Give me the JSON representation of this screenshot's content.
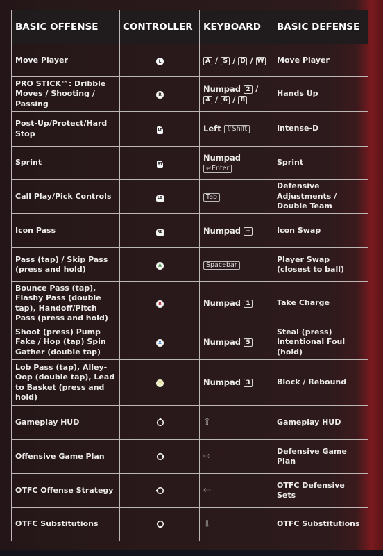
{
  "headers": {
    "offense": "BASIC OFFENSE",
    "controller": "CONTROLLER",
    "keyboard": "KEYBOARD",
    "defense": "BASIC DEFENSE"
  },
  "rows": [
    {
      "offense": "Move Player",
      "controller": {
        "icon": "left-stick-icon",
        "label": "L"
      },
      "keyboard_prefix": "",
      "keys": [
        "A",
        "S",
        "D",
        "W"
      ],
      "defense": "Move Player"
    },
    {
      "offense": "PRO STICK™: Dribble Moves / Shooting / Passing",
      "controller": {
        "icon": "right-stick-icon",
        "label": "R"
      },
      "keyboard_prefix": "Numpad",
      "keys": [
        "2",
        "4",
        "6",
        "8"
      ],
      "defense": "Hands Up"
    },
    {
      "offense": "Post-Up/Protect/Hard Stop",
      "controller": {
        "icon": "left-trigger-icon",
        "label": "LT"
      },
      "keyboard_prefix": "Left",
      "keys": [
        "⇧Shift"
      ],
      "defense": "Intense-D"
    },
    {
      "offense": "Sprint",
      "controller": {
        "icon": "right-trigger-icon",
        "label": "RT"
      },
      "keyboard_prefix": "Numpad",
      "keys": [
        "↵Enter"
      ],
      "defense": "Sprint"
    },
    {
      "offense": "Call Play/Pick Controls",
      "controller": {
        "icon": "left-bumper-icon",
        "label": "LB"
      },
      "keyboard_prefix": "",
      "keys": [
        "Tab"
      ],
      "defense": "Defensive Adjustments / Double Team"
    },
    {
      "offense": "Icon Pass",
      "controller": {
        "icon": "right-bumper-icon",
        "label": "RB"
      },
      "keyboard_prefix": "Numpad",
      "keys": [
        "+"
      ],
      "defense": "Icon Swap"
    },
    {
      "offense": "Pass (tap) / Skip Pass (press and hold)",
      "controller": {
        "icon": "a-button-icon",
        "label": "A"
      },
      "keyboard_prefix": "",
      "keys": [
        "Spacebar"
      ],
      "defense": "Player Swap (closest to ball)"
    },
    {
      "offense": "Bounce Pass (tap), Flashy Pass (double tap), Handoff/Pitch Pass (press and hold)",
      "controller": {
        "icon": "b-button-icon",
        "label": "B"
      },
      "keyboard_prefix": "Numpad",
      "keys": [
        "1"
      ],
      "defense": "Take Charge"
    },
    {
      "offense": "Shoot (press) Pump Fake / Hop (tap) Spin Gather (double tap)",
      "controller": {
        "icon": "x-button-icon",
        "label": "X"
      },
      "keyboard_prefix": "Numpad",
      "keys": [
        "5"
      ],
      "defense": "Steal (press) Intentional Foul (hold)"
    },
    {
      "offense": "Lob Pass (tap), Alley-Oop (double tap), Lead to Basket (press and hold)",
      "controller": {
        "icon": "y-button-icon",
        "label": "Y"
      },
      "keyboard_prefix": "Numpad",
      "keys": [
        "3"
      ],
      "defense": "Block / Rebound"
    },
    {
      "offense": "Gameplay HUD",
      "controller": {
        "icon": "dpad-up-icon",
        "label": ""
      },
      "keyboard_prefix": "",
      "arrow": "⇧",
      "arrow_icon": "arrow-up-icon",
      "defense": "Gameplay HUD"
    },
    {
      "offense": "Offensive Game Plan",
      "controller": {
        "icon": "dpad-right-icon",
        "label": ""
      },
      "keyboard_prefix": "",
      "arrow": "⇨",
      "arrow_icon": "arrow-right-icon",
      "defense": "Defensive Game Plan"
    },
    {
      "offense": "OTFC Offense Strategy",
      "controller": {
        "icon": "dpad-left-icon",
        "label": ""
      },
      "keyboard_prefix": "",
      "arrow": "⇦",
      "arrow_icon": "arrow-left-icon",
      "defense": "OTFC Defensive Sets"
    },
    {
      "offense": "OTFC Substitutions",
      "controller": {
        "icon": "dpad-down-icon",
        "label": ""
      },
      "keyboard_prefix": "",
      "arrow": "⇩",
      "arrow_icon": "arrow-down-icon",
      "defense": "OTFC Substitutions"
    }
  ]
}
